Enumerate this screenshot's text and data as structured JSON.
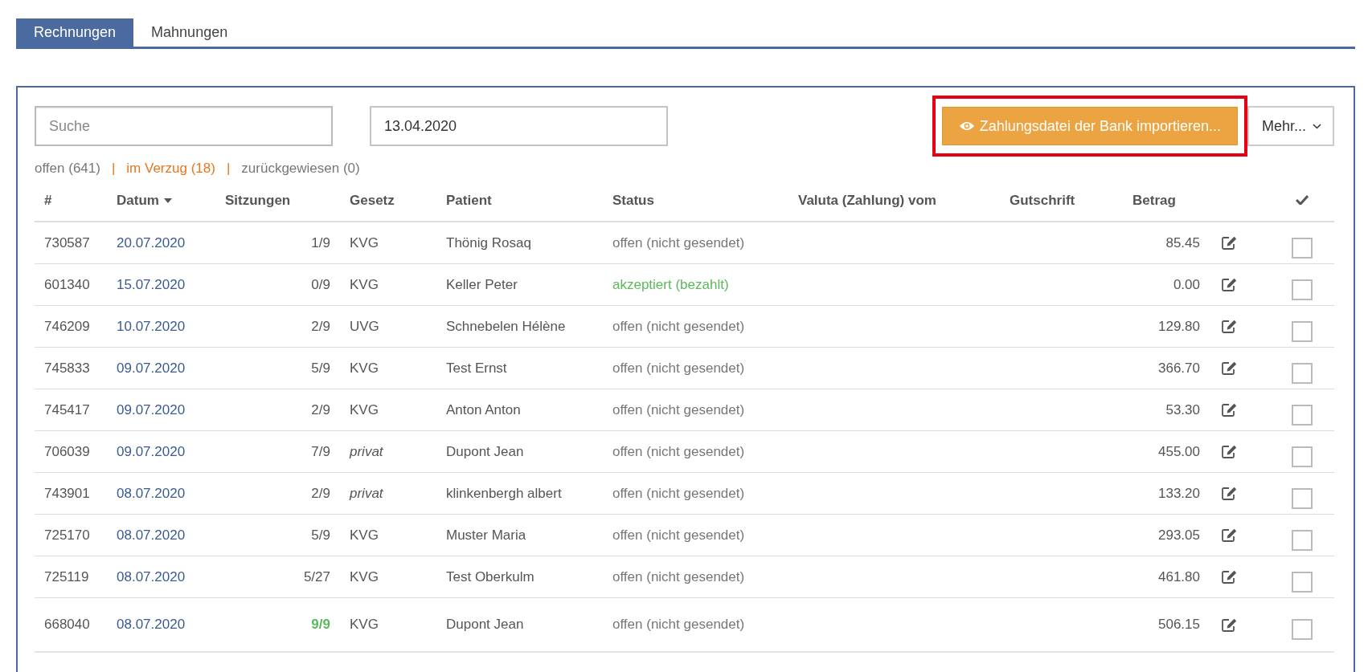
{
  "tabs": [
    {
      "label": "Rechnungen",
      "selected": true
    },
    {
      "label": "Mahnungen",
      "selected": false
    }
  ],
  "search": {
    "placeholder": "Suche"
  },
  "date_field": {
    "value": "13.04.2020"
  },
  "import_button": {
    "label": "Zahlungsdatei der Bank importieren...",
    "highlighted": true
  },
  "more_button": {
    "label": "Mehr..."
  },
  "filters": [
    {
      "label": "offen (641)",
      "color": "#777777"
    },
    {
      "label": "im Verzug (18)",
      "color": "#e8761e"
    },
    {
      "label": "zurückgewiesen (0)",
      "color": "#777777"
    }
  ],
  "filter_separators": [
    "|",
    "|"
  ],
  "table": {
    "columns": [
      {
        "label": "#",
        "sorted": false
      },
      {
        "label": "Datum",
        "sorted": true
      },
      {
        "label": "Sitzungen",
        "sorted": false
      },
      {
        "label": "Gesetz",
        "sorted": false
      },
      {
        "label": "Patient",
        "sorted": false
      },
      {
        "label": "Status",
        "sorted": false
      },
      {
        "label": "Valuta (Zahlung) vom",
        "sorted": false
      },
      {
        "label": "Gutschrift",
        "sorted": false
      },
      {
        "label": "Betrag",
        "sorted": false
      }
    ],
    "rows": [
      {
        "number": "730587",
        "date": "20.07.2020",
        "sessions": "1/9",
        "sessions_complete": false,
        "law": "KVG",
        "law_italic": false,
        "patient": "Thönig Rosaq",
        "status": {
          "text": "offen (nicht gesendet)",
          "color": "#777777"
        },
        "amount": "85.45",
        "checked": false
      },
      {
        "number": "601340",
        "date": "15.07.2020",
        "sessions": "0/9",
        "sessions_complete": false,
        "law": "KVG",
        "law_italic": false,
        "patient": "Keller Peter",
        "status": {
          "text": "akzeptiert (bezahlt)",
          "color": "#5cb85c"
        },
        "amount": "0.00",
        "checked": false
      },
      {
        "number": "746209",
        "date": "10.07.2020",
        "sessions": "2/9",
        "sessions_complete": false,
        "law": "UVG",
        "law_italic": false,
        "patient": "Schnebelen Hélène",
        "status": {
          "text": "offen (nicht gesendet)",
          "color": "#777777"
        },
        "amount": "129.80",
        "checked": false
      },
      {
        "number": "745833",
        "date": "09.07.2020",
        "sessions": "5/9",
        "sessions_complete": false,
        "law": "KVG",
        "law_italic": false,
        "patient": "Test Ernst",
        "status": {
          "text": "offen (nicht gesendet)",
          "color": "#777777"
        },
        "amount": "366.70",
        "checked": false
      },
      {
        "number": "745417",
        "date": "09.07.2020",
        "sessions": "2/9",
        "sessions_complete": false,
        "law": "KVG",
        "law_italic": false,
        "patient": "Anton Anton",
        "status": {
          "text": "offen (nicht gesendet)",
          "color": "#777777"
        },
        "amount": "53.30",
        "checked": false
      },
      {
        "number": "706039",
        "date": "09.07.2020",
        "sessions": "7/9",
        "sessions_complete": false,
        "law": "privat",
        "law_italic": true,
        "patient": "Dupont Jean",
        "status": {
          "text": "offen (nicht gesendet)",
          "color": "#777777"
        },
        "amount": "455.00",
        "checked": false
      },
      {
        "number": "743901",
        "date": "08.07.2020",
        "sessions": "2/9",
        "sessions_complete": false,
        "law": "privat",
        "law_italic": true,
        "patient": "klinkenbergh albert",
        "status": {
          "text": "offen (nicht gesendet)",
          "color": "#777777"
        },
        "amount": "133.20",
        "checked": false
      },
      {
        "number": "725170",
        "date": "08.07.2020",
        "sessions": "5/9",
        "sessions_complete": false,
        "law": "KVG",
        "law_italic": false,
        "patient": "Muster Maria",
        "status": {
          "text": "offen (nicht gesendet)",
          "color": "#777777"
        },
        "amount": "293.05",
        "checked": false
      },
      {
        "number": "725119",
        "date": "08.07.2020",
        "sessions": "5/27",
        "sessions_complete": false,
        "law": "KVG",
        "law_italic": false,
        "patient": "Test Oberkulm",
        "status": {
          "text": "offen (nicht gesendet)",
          "color": "#777777"
        },
        "amount": "461.80",
        "checked": false
      },
      {
        "number": "668040",
        "date": "08.07.2020",
        "sessions": "9/9",
        "sessions_complete": true,
        "law": "KVG",
        "law_italic": false,
        "patient": "Dupont Jean",
        "status": {
          "text": "offen (nicht gesendet)",
          "color": "#777777"
        },
        "amount": "506.15",
        "checked": false
      }
    ]
  }
}
